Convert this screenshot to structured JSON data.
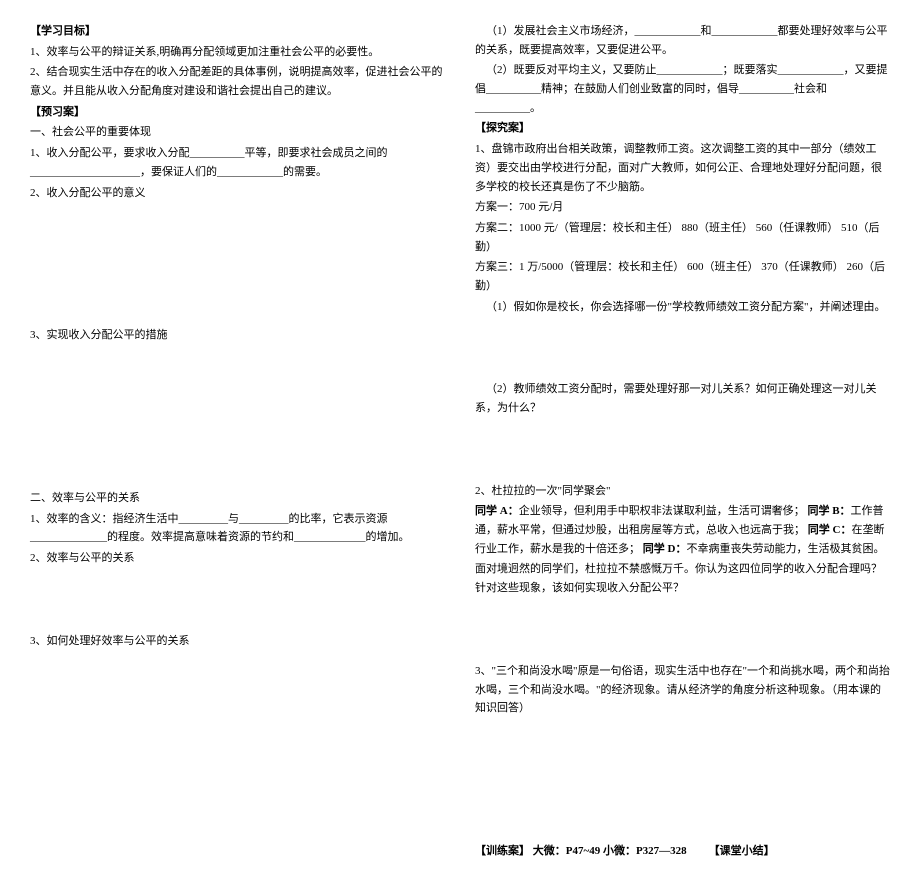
{
  "left": {
    "h1": "【学习目标】",
    "l1": "1、效率与公平的辩证关系,明确再分配领域更加注重社会公平的必要性。",
    "l2": "2、结合现实生活中存在的收入分配差距的具体事例，说明提高效率，促进社会公平的意义。并且能从收入分配角度对建设和谐社会提出自己的建议。",
    "h2": "【预习案】",
    "s1_title": "一、社会公平的重要体现",
    "s1_l1": "1、收入分配公平，要求收入分配__________平等，即要求社会成员之间的____________________，要保证人们的____________的需要。",
    "s1_l2": "2、收入分配公平的意义",
    "s1_l3": "3、实现收入分配公平的措施",
    "s2_title": "二、效率与公平的关系",
    "s2_l1": "1、效率的含义：指经济生活中_________与_________的比率，它表示资源______________的程度。效率提高意味着资源的节约和_____________的增加。",
    "s2_l2": "2、效率与公平的关系",
    "s2_l3": "3、如何处理好效率与公平的关系"
  },
  "right": {
    "r1": "（1）发展社会主义市场经济，____________和____________都要处理好效率与公平的关系，既要提高效率，又要促进公平。",
    "r2": "（2）既要反对平均主义，又要防止____________；既要落实____________，又要提倡__________精神；在鼓励人们创业致富的同时，倡导__________社会和__________。",
    "h3": "【探究案】",
    "t1": "1、盘锦市政府出台相关政策，调整教师工资。这次调整工资的其中一部分（绩效工资）要交出由学校进行分配，面对广大教师，如何公正、合理地处理好分配问题，很多学校的校长还真是伤了不少脑筋。",
    "t1_a": "方案一：700 元/月",
    "t1_b": "方案二：1000 元/（管理层：校长和主任）    880（班主任）    560（任课教师）    510（后勤）",
    "t1_c": "方案三：1 万/5000（管理层：校长和主任）    600（班主任）    370（任课教师）    260（后勤）",
    "t1_q1": "（1）假如你是校长，你会选择哪一份\"学校教师绩效工资分配方案\"，并阐述理由。",
    "t1_q2": "（2）教师绩效工资分配时，需要处理好那一对儿关系？如何正确处理这一对儿关系，为什么？",
    "t2_title": "2、杜拉拉的一次\"同学聚会\"",
    "t2_a": "同学 A：",
    "t2_a_text": "企业领导，但利用手中职权非法谋取利益，生活可谓奢侈；",
    "t2_b": "同学 B：",
    "t2_b_text": "工作普通，薪水平常，但通过炒股，出租房屋等方式，总收入也远高于我；",
    "t2_c": "同学 C：",
    "t2_c_text": "在垄断行业工作，薪水是我的十倍还多；",
    "t2_d": "同学 D：",
    "t2_d_text": "不幸病重丧失劳动能力，生活极其贫困。",
    "t2_q": "面对境迥然的同学们，杜拉拉不禁感慨万千。你认为这四位同学的收入分配合理吗？针对这些现象，该如何实现收入分配公平？",
    "t3": "3、\"三个和尚没水喝\"原是一句俗语，现实生活中也存在\"一个和尚挑水喝，两个和尚抬水喝，三个和尚没水喝。\"的经济现象。请从经济学的角度分析这种现象。（用本课的知识回答）",
    "footer1": "【训练案】  大微：P47~49   小微：P327—328",
    "footer2": "【课堂小结】"
  }
}
